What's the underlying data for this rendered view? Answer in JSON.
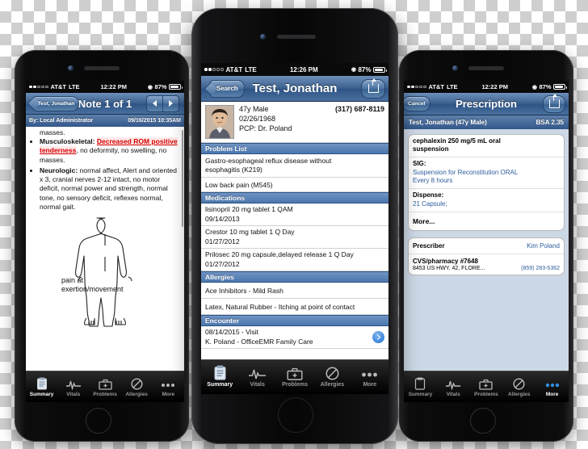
{
  "background": {
    "type": "transparency-checkerboard"
  },
  "phones": {
    "left": {
      "device": "smartphone-left",
      "statusbar": {
        "carrier": "AT&T",
        "network": "LTE",
        "time": "12:22 PM",
        "battery": "87%",
        "signal_dots": 2
      },
      "navbar": {
        "back_label": "Test, Jonathan",
        "title": "Note 1 of 1",
        "prev_icon": "triangle-left-icon",
        "next_icon": "triangle-right-icon"
      },
      "subbar": {
        "author": "By: Local Administrator",
        "timestamp": "09/16/2015 10:35AM"
      },
      "note": {
        "lead": "masses.",
        "items": [
          {
            "label": "Musculoskeletal:",
            "highlight": "Decreased ROM positive tenderness",
            "rest": ", no deformity, no swelling, no masses."
          },
          {
            "label": "Neurologic:",
            "highlight": "",
            "rest": "normal affect, Alert and oriented x 3, cranial nerves 2-12 intact, no motor deficit, normal power and strength, normal tone, no sensory deficit, reflexes normal, normal gait."
          }
        ],
        "diagram_label_line1": "pain at",
        "diagram_label_line2": "exertion/movement",
        "diagram_icon": "human-body-outline"
      },
      "tabs": [
        {
          "label": "Summary",
          "icon": "clipboard-icon",
          "active": true
        },
        {
          "label": "Vitals",
          "icon": "waveform-icon",
          "active": false
        },
        {
          "label": "Problems",
          "icon": "medical-bag-icon",
          "active": false
        },
        {
          "label": "Allergies",
          "icon": "no-entry-icon",
          "active": false
        },
        {
          "label": "More",
          "icon": "ellipsis-icon",
          "active": false
        }
      ]
    },
    "center": {
      "device": "smartphone-center",
      "statusbar": {
        "carrier": "AT&T",
        "network": "LTE",
        "time": "12:26 PM",
        "battery": "87%",
        "signal_dots": 2
      },
      "navbar": {
        "back_label": "Search",
        "title": "Test, Jonathan",
        "share_icon": "share-icon"
      },
      "patient": {
        "avatar": "patient-photo",
        "age_sex": "47y Male",
        "dob": "02/26/1968",
        "pcp": "PCP: Dr. Poland",
        "phone": "(317) 687-8119"
      },
      "sections": [
        {
          "title": "Problem List",
          "rows": [
            {
              "line1": "Gastro-esophageal reflux disease without",
              "line2": "esophagitis (K219)"
            },
            {
              "line1": "Low back pain (M545)",
              "line2": ""
            }
          ]
        },
        {
          "title": "Medications",
          "rows": [
            {
              "line1": "lisinopril 20 mg tablet 1 QAM",
              "line2": "09/14/2013"
            },
            {
              "line1": "Crestor 10 mg tablet 1 Q Day",
              "line2": "01/27/2012"
            },
            {
              "line1": "Prilosec 20 mg capsule,delayed release 1 Q Day",
              "line2": "01/27/2012"
            }
          ]
        },
        {
          "title": "Allergies",
          "rows": [
            {
              "line1": "Ace Inhibitors - Mild Rash",
              "line2": ""
            },
            {
              "line1": "Latex, Natural Rubber - Itching at point of contact",
              "line2": ""
            }
          ]
        },
        {
          "title": "Encounter",
          "rows": [
            {
              "line1": "08/14/2015 - Visit",
              "line2": "K. Poland - OfficeEMR Family Care",
              "chevron": "chevron-right-icon"
            }
          ]
        }
      ],
      "tabs": [
        {
          "label": "Summary",
          "icon": "clipboard-icon",
          "active": true
        },
        {
          "label": "Vitals",
          "icon": "waveform-icon",
          "active": false
        },
        {
          "label": "Problems",
          "icon": "medical-bag-icon",
          "active": false
        },
        {
          "label": "Allergies",
          "icon": "no-entry-icon",
          "active": false
        },
        {
          "label": "More",
          "icon": "ellipsis-icon",
          "active": false
        }
      ]
    },
    "right": {
      "device": "smartphone-right",
      "statusbar": {
        "carrier": "AT&T",
        "network": "LTE",
        "time": "12:22 PM",
        "battery": "87%",
        "signal_dots": 2
      },
      "navbar": {
        "back_label": "Cancel",
        "title": "Prescription",
        "share_icon": "share-icon"
      },
      "subbar": {
        "patient": "Test, Jonathan (47y Male)",
        "bsa": "BSA 2.35"
      },
      "rx": {
        "drug_line1": "cephalexin 250 mg/5 mL oral",
        "drug_line2": "suspension",
        "sig_label": "SIG:",
        "sig_line1": "Suspension for Reconstitution ORAL",
        "sig_line2": "Every 8 hours",
        "dispense_label": "Dispense:",
        "dispense_value": "21 Capsule;",
        "more_label": "More..."
      },
      "prescriber": {
        "label": "Prescriber",
        "name": "Kim Poland"
      },
      "pharmacy": {
        "name": "CVS/pharmacy #7648",
        "address": "8453 US HWY. 42, FLORE...",
        "phone": "(859) 283-5362"
      },
      "tabs": [
        {
          "label": "Summary",
          "icon": "clipboard-icon",
          "active": false
        },
        {
          "label": "Vitals",
          "icon": "waveform-icon",
          "active": false
        },
        {
          "label": "Problems",
          "icon": "medical-bag-icon",
          "active": false
        },
        {
          "label": "Allergies",
          "icon": "no-entry-icon",
          "active": false
        },
        {
          "label": "More",
          "icon": "ellipsis-dots-icon",
          "active": true
        }
      ]
    }
  },
  "colors": {
    "nav_blue": "#3f6390",
    "section_blue": "#4c77ad",
    "alert_red": "#d40000",
    "link_blue": "#2f5d9e"
  }
}
